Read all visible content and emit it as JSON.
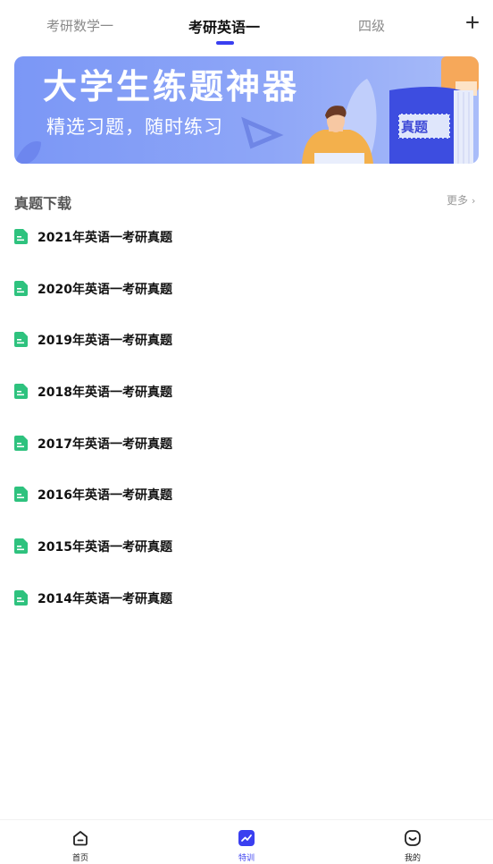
{
  "tabs": [
    {
      "label": "考研数学一"
    },
    {
      "label": "考研英语一"
    },
    {
      "label": "四级"
    }
  ],
  "active_tab_index": 1,
  "accent_color": "#3a3ff0",
  "doc_icon_color": "#2ec27e",
  "banner": {
    "title": "大学生练题神器",
    "subtitle": "精选习题，随时练习",
    "book_text": "真题"
  },
  "section": {
    "title": "真题下载",
    "more_label": "更多"
  },
  "items": [
    {
      "label": "2021年英语一考研真题"
    },
    {
      "label": "2020年英语一考研真题"
    },
    {
      "label": "2019年英语一考研真题"
    },
    {
      "label": "2018年英语一考研真题"
    },
    {
      "label": "2017年英语一考研真题"
    },
    {
      "label": "2016年英语一考研真题"
    },
    {
      "label": "2015年英语一考研真题"
    },
    {
      "label": "2014年英语一考研真题"
    }
  ],
  "bottom_nav": [
    {
      "label": "首页",
      "icon": "home-icon"
    },
    {
      "label": "特训",
      "icon": "training-icon"
    },
    {
      "label": "我的",
      "icon": "profile-icon"
    }
  ],
  "active_nav_index": 1
}
